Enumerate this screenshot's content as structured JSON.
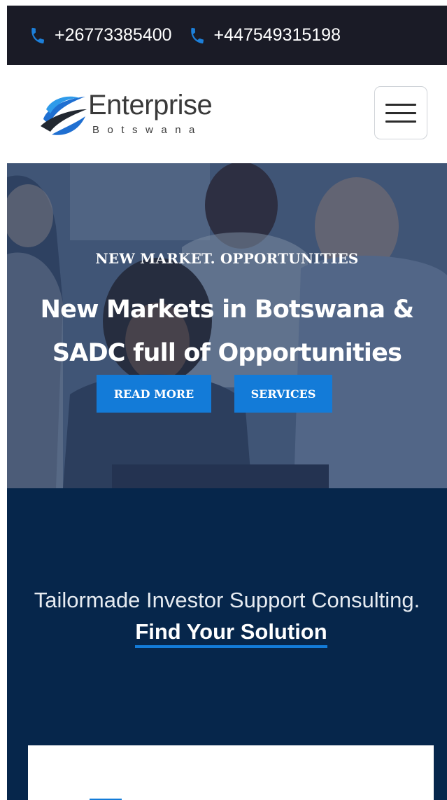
{
  "topbar": {
    "phones": [
      {
        "icon": "phone-icon",
        "number": "+26773385400"
      },
      {
        "icon": "phone-icon",
        "number": "+447549315198"
      }
    ]
  },
  "header": {
    "logo": {
      "name": "Enterprise",
      "subtitle": "Botswana"
    },
    "menu_icon": "hamburger-menu-icon"
  },
  "hero": {
    "kicker": "NEW MARKET. OPPORTUNITIES",
    "title": "New Markets in Botswana & SADC full of Opportunities",
    "buttons": {
      "read_more": "READ MORE",
      "services": "SERVICES"
    }
  },
  "support": {
    "text": "Tailormade Investor Support Consulting.",
    "link": "Find Your Solution"
  },
  "colors": {
    "topbar_bg": "#1a1b26",
    "phone_icon": "#1c7fd9",
    "accent": "#137bd8",
    "navy_section": "#06264b"
  }
}
